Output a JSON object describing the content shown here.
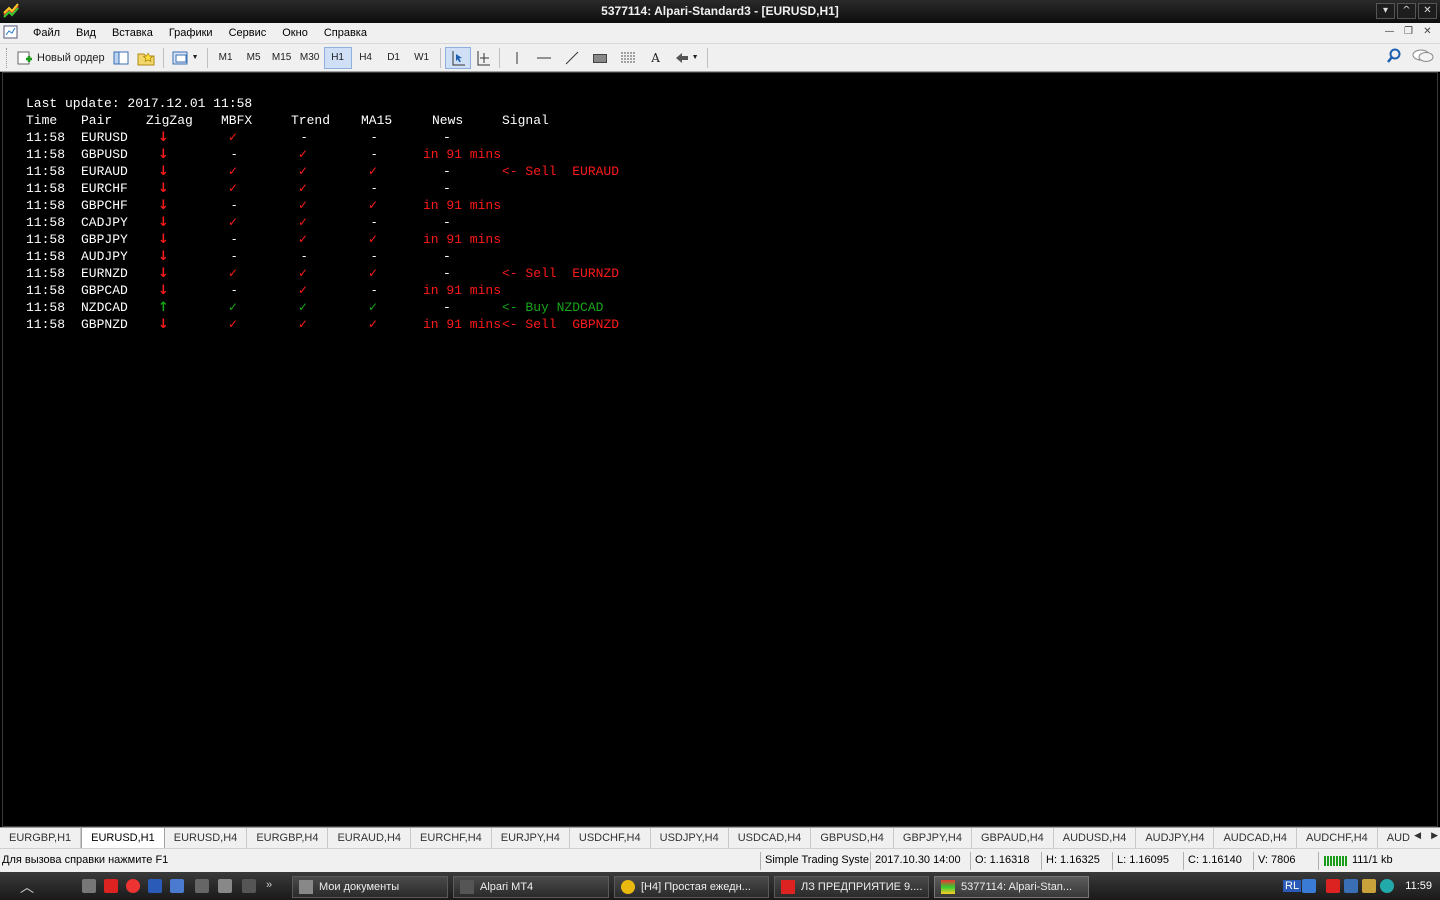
{
  "window": {
    "title": "5377114: Alpari-Standard3 - [EURUSD,H1]",
    "controls": [
      "⌵",
      "⌂",
      "✕"
    ]
  },
  "menu": [
    "Файл",
    "Вид",
    "Вставка",
    "Графики",
    "Сервис",
    "Окно",
    "Справка"
  ],
  "toolbar": {
    "new_order": "Новый ордер",
    "timeframes": [
      "M1",
      "M5",
      "M15",
      "M30",
      "H1",
      "H4",
      "D1",
      "W1"
    ],
    "active_timeframe": "H1",
    "text_tool": "A"
  },
  "panel": {
    "last_update": "Last update: 2017.12.01 11:58",
    "headers": {
      "time": "Time",
      "pair": "Pair",
      "zigzag": "ZigZag",
      "mbfx": "MBFX",
      "trend": "Trend",
      "ma15": "MA15",
      "news": "News",
      "signal": "Signal"
    },
    "rows": [
      {
        "time": "11:58",
        "pair": "EURUSD",
        "zigzag": "↓",
        "zz": "red",
        "mbfx": "✓",
        "mbfx_c": "red",
        "trend": "-",
        "trend_c": "white",
        "ma15": "-",
        "ma15_c": "white",
        "news": "-",
        "news_c": "white",
        "signal": "",
        "signal_c": "red"
      },
      {
        "time": "11:58",
        "pair": "GBPUSD",
        "zigzag": "↓",
        "zz": "red",
        "mbfx": "-",
        "mbfx_c": "white",
        "trend": "✓",
        "trend_c": "red",
        "ma15": "-",
        "ma15_c": "white",
        "news": "in 91 mins",
        "news_c": "red",
        "signal": "",
        "signal_c": "red"
      },
      {
        "time": "11:58",
        "pair": "EURAUD",
        "zigzag": "↓",
        "zz": "red",
        "mbfx": "✓",
        "mbfx_c": "red",
        "trend": "✓",
        "trend_c": "red",
        "ma15": "✓",
        "ma15_c": "red",
        "news": "-",
        "news_c": "white",
        "signal": "<- Sell  EURAUD",
        "signal_c": "red"
      },
      {
        "time": "11:58",
        "pair": "EURCHF",
        "zigzag": "↓",
        "zz": "red",
        "mbfx": "✓",
        "mbfx_c": "red",
        "trend": "✓",
        "trend_c": "red",
        "ma15": "-",
        "ma15_c": "white",
        "news": "-",
        "news_c": "white",
        "signal": "",
        "signal_c": "red"
      },
      {
        "time": "11:58",
        "pair": "GBPCHF",
        "zigzag": "↓",
        "zz": "red",
        "mbfx": "-",
        "mbfx_c": "white",
        "trend": "✓",
        "trend_c": "red",
        "ma15": "✓",
        "ma15_c": "red",
        "news": "in 91 mins",
        "news_c": "red",
        "signal": "",
        "signal_c": "red"
      },
      {
        "time": "11:58",
        "pair": "CADJPY",
        "zigzag": "↓",
        "zz": "red",
        "mbfx": "✓",
        "mbfx_c": "red",
        "trend": "✓",
        "trend_c": "red",
        "ma15": "-",
        "ma15_c": "white",
        "news": "-",
        "news_c": "white",
        "signal": "",
        "signal_c": "red"
      },
      {
        "time": "11:58",
        "pair": "GBPJPY",
        "zigzag": "↓",
        "zz": "red",
        "mbfx": "-",
        "mbfx_c": "white",
        "trend": "✓",
        "trend_c": "red",
        "ma15": "✓",
        "ma15_c": "red",
        "news": "in 91 mins",
        "news_c": "red",
        "signal": "",
        "signal_c": "red"
      },
      {
        "time": "11:58",
        "pair": "AUDJPY",
        "zigzag": "↓",
        "zz": "red",
        "mbfx": "-",
        "mbfx_c": "white",
        "trend": "-",
        "trend_c": "white",
        "ma15": "-",
        "ma15_c": "white",
        "news": "-",
        "news_c": "white",
        "signal": "",
        "signal_c": "red"
      },
      {
        "time": "11:58",
        "pair": "EURNZD",
        "zigzag": "↓",
        "zz": "red",
        "mbfx": "✓",
        "mbfx_c": "red",
        "trend": "✓",
        "trend_c": "red",
        "ma15": "✓",
        "ma15_c": "red",
        "news": "-",
        "news_c": "white",
        "signal": "<- Sell  EURNZD",
        "signal_c": "red"
      },
      {
        "time": "11:58",
        "pair": "GBPCAD",
        "zigzag": "↓",
        "zz": "red",
        "mbfx": "-",
        "mbfx_c": "white",
        "trend": "✓",
        "trend_c": "red",
        "ma15": "-",
        "ma15_c": "white",
        "news": "in 91 mins",
        "news_c": "red",
        "signal": "",
        "signal_c": "red"
      },
      {
        "time": "11:58",
        "pair": "NZDCAD",
        "zigzag": "↑",
        "zz": "green",
        "mbfx": "✓",
        "mbfx_c": "green",
        "trend": "✓",
        "trend_c": "green",
        "ma15": "✓",
        "ma15_c": "green",
        "news": "-",
        "news_c": "white",
        "signal": "<- Buy NZDCAD",
        "signal_c": "green"
      },
      {
        "time": "11:58",
        "pair": "GBPNZD",
        "zigzag": "↓",
        "zz": "red",
        "mbfx": "✓",
        "mbfx_c": "red",
        "trend": "✓",
        "trend_c": "red",
        "ma15": "✓",
        "ma15_c": "red",
        "news": "in 91 mins",
        "news_c": "red",
        "signal": "<- Sell  GBPNZD",
        "signal_c": "red"
      }
    ]
  },
  "tabs": [
    "EURGBP,H1",
    "EURUSD,H1",
    "EURUSD,H4",
    "EURGBP,H4",
    "EURAUD,H4",
    "EURCHF,H4",
    "EURJPY,H4",
    "USDCHF,H4",
    "USDJPY,H4",
    "USDCAD,H4",
    "GBPUSD,H4",
    "GBPJPY,H4",
    "GBPAUD,H4",
    "AUDUSD,H4",
    "AUDJPY,H4",
    "AUDCAD,H4",
    "AUDCHF,H4",
    "AUDNZD"
  ],
  "active_tab": "EURUSD,H1",
  "status": {
    "help": "Для вызова справки нажмите F1",
    "profile": "Simple Trading Syster",
    "datetime": "2017.10.30 14:00",
    "open": "O: 1.16318",
    "high": "H: 1.16325",
    "low": "L: 1.16095",
    "close": "C: 1.16140",
    "volume": "V: 7806",
    "traffic": "111/1 kb"
  },
  "taskbar": {
    "tasks": [
      "Мои документы",
      "Alpari MT4",
      "[H4] Простая ежедн...",
      "ЛЗ ПРЕДПРИЯТИЕ 9....",
      "5377114: Alpari-Stan..."
    ],
    "lang": "RL",
    "clock": "11:59"
  },
  "colors": {
    "red": "#ff1a1a",
    "green": "#17a51a",
    "white": "#ffffff"
  }
}
